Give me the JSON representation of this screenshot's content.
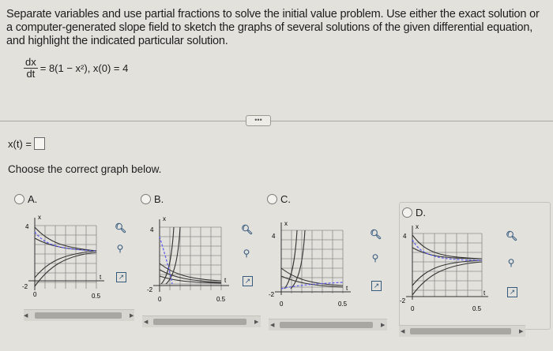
{
  "question": {
    "text": "Separate variables and use partial fractions to solve the initial value problem. Use either the exact solution or a computer-generated slope field to sketch the graphs of several solutions of the given differential equation, and highlight the indicated particular solution."
  },
  "equation": {
    "numerator": "dx",
    "denominator": "dt",
    "rhs": "= 8(1 − x²), x(0) = 4"
  },
  "more_button": "•••",
  "answer": {
    "label": "x(t) ="
  },
  "prompt": "Choose the correct graph below.",
  "options": [
    {
      "label": "A."
    },
    {
      "label": "B."
    },
    {
      "label": "C."
    },
    {
      "label": "D."
    }
  ],
  "graph": {
    "y_tick": "4",
    "y_neg_tick": "-2",
    "x_origin": "0",
    "x_tick": "0.5",
    "y_axis_label": "x",
    "x_axis_label": "t"
  },
  "icons": {
    "zoom_in": "magnify-plus-icon",
    "zoom_out": "magnify-minus-icon",
    "open": "external-link-icon"
  },
  "colors": {
    "background": "#e3e1dc",
    "link_blue": "#355a7e"
  }
}
